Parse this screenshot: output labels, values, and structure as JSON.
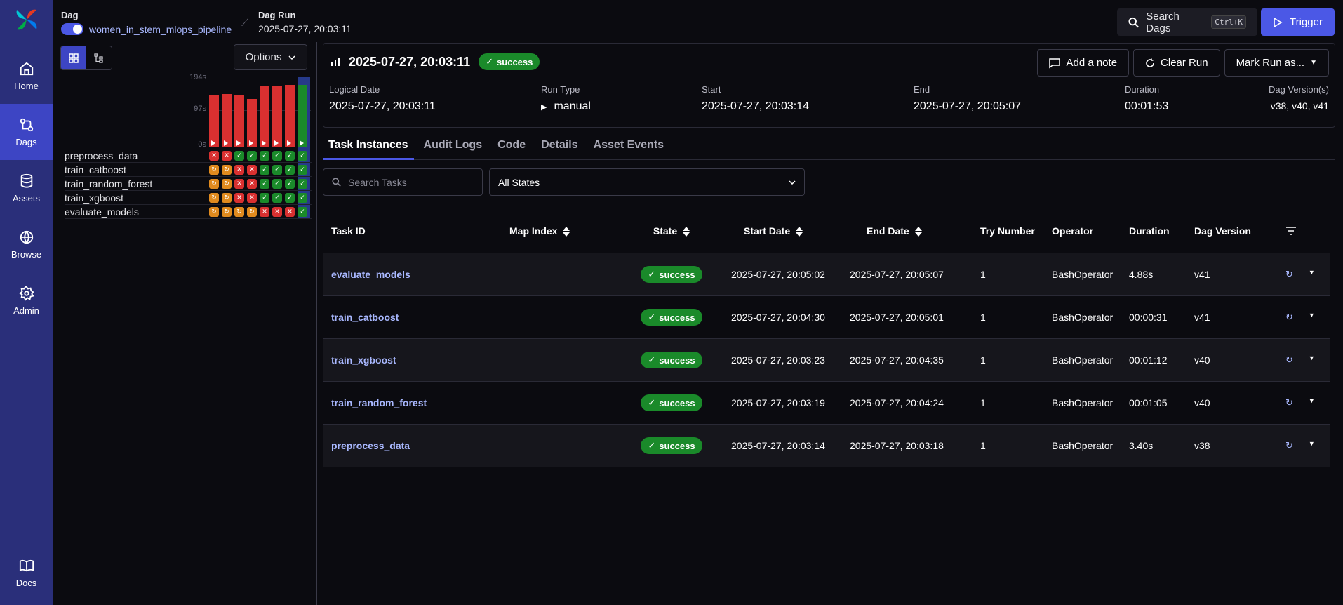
{
  "sidebar": {
    "items": [
      {
        "label": "Home",
        "icon": "home-icon"
      },
      {
        "label": "Dags",
        "icon": "dags-icon",
        "active": true
      },
      {
        "label": "Assets",
        "icon": "database-icon"
      },
      {
        "label": "Browse",
        "icon": "globe-icon"
      },
      {
        "label": "Admin",
        "icon": "gear-icon"
      }
    ],
    "docs_label": "Docs"
  },
  "header": {
    "dag_label": "Dag",
    "dag_name": "women_in_stem_mlops_pipeline",
    "dag_run_label": "Dag Run",
    "dag_run_value": "2025-07-27, 20:03:11",
    "search_label": "Search Dags",
    "search_shortcut": "Ctrl+K",
    "trigger_label": "Trigger"
  },
  "grid": {
    "options_label": "Options",
    "axis": [
      "194s",
      "97s",
      "0s"
    ],
    "bar_values_s": [
      148,
      150,
      146,
      136,
      172,
      172,
      176,
      176
    ],
    "tasks": [
      {
        "name": "preprocess_data",
        "states": [
          "fail",
          "fail",
          "ok",
          "ok",
          "ok",
          "ok",
          "ok",
          "ok"
        ]
      },
      {
        "name": "train_catboost",
        "states": [
          "retry",
          "retry",
          "fail",
          "fail",
          "ok",
          "ok",
          "ok",
          "ok"
        ]
      },
      {
        "name": "train_random_forest",
        "states": [
          "retry",
          "retry",
          "fail",
          "fail",
          "ok",
          "ok",
          "ok",
          "ok"
        ]
      },
      {
        "name": "train_xgboost",
        "states": [
          "retry",
          "retry",
          "fail",
          "fail",
          "ok",
          "ok",
          "ok",
          "ok"
        ]
      },
      {
        "name": "evaluate_models",
        "states": [
          "retry",
          "retry",
          "retry",
          "retry",
          "fail",
          "fail",
          "fail",
          "ok"
        ]
      }
    ]
  },
  "run": {
    "title": "2025-07-27, 20:03:11",
    "state": "success",
    "actions": {
      "note": "Add a note",
      "clear": "Clear Run",
      "mark": "Mark Run as..."
    },
    "meta": {
      "logical_date_label": "Logical Date",
      "logical_date": "2025-07-27, 20:03:11",
      "run_type_label": "Run Type",
      "run_type": "manual",
      "start_label": "Start",
      "start": "2025-07-27, 20:03:14",
      "end_label": "End",
      "end": "2025-07-27, 20:05:07",
      "duration_label": "Duration",
      "duration": "00:01:53",
      "version_label": "Dag Version(s)",
      "version": "v38, v40, v41"
    }
  },
  "tabs": [
    "Task Instances",
    "Audit Logs",
    "Code",
    "Details",
    "Asset Events"
  ],
  "filters": {
    "search_placeholder": "Search Tasks",
    "states_value": "All States"
  },
  "table": {
    "headers": [
      "Task ID",
      "Map Index",
      "State",
      "Start Date",
      "End Date",
      "Try Number",
      "Operator",
      "Duration",
      "Dag Version"
    ],
    "rows": [
      {
        "task_id": "evaluate_models",
        "state": "success",
        "start": "2025-07-27, 20:05:02",
        "end": "2025-07-27, 20:05:07",
        "try": "1",
        "operator": "BashOperator",
        "duration": "4.88s",
        "version": "v41"
      },
      {
        "task_id": "train_catboost",
        "state": "success",
        "start": "2025-07-27, 20:04:30",
        "end": "2025-07-27, 20:05:01",
        "try": "1",
        "operator": "BashOperator",
        "duration": "00:00:31",
        "version": "v41"
      },
      {
        "task_id": "train_xgboost",
        "state": "success",
        "start": "2025-07-27, 20:03:23",
        "end": "2025-07-27, 20:04:35",
        "try": "1",
        "operator": "BashOperator",
        "duration": "00:01:12",
        "version": "v40"
      },
      {
        "task_id": "train_random_forest",
        "state": "success",
        "start": "2025-07-27, 20:03:19",
        "end": "2025-07-27, 20:04:24",
        "try": "1",
        "operator": "BashOperator",
        "duration": "00:01:05",
        "version": "v40"
      },
      {
        "task_id": "preprocess_data",
        "state": "success",
        "start": "2025-07-27, 20:03:14",
        "end": "2025-07-27, 20:03:18",
        "try": "1",
        "operator": "BashOperator",
        "duration": "3.40s",
        "version": "v38"
      }
    ]
  }
}
